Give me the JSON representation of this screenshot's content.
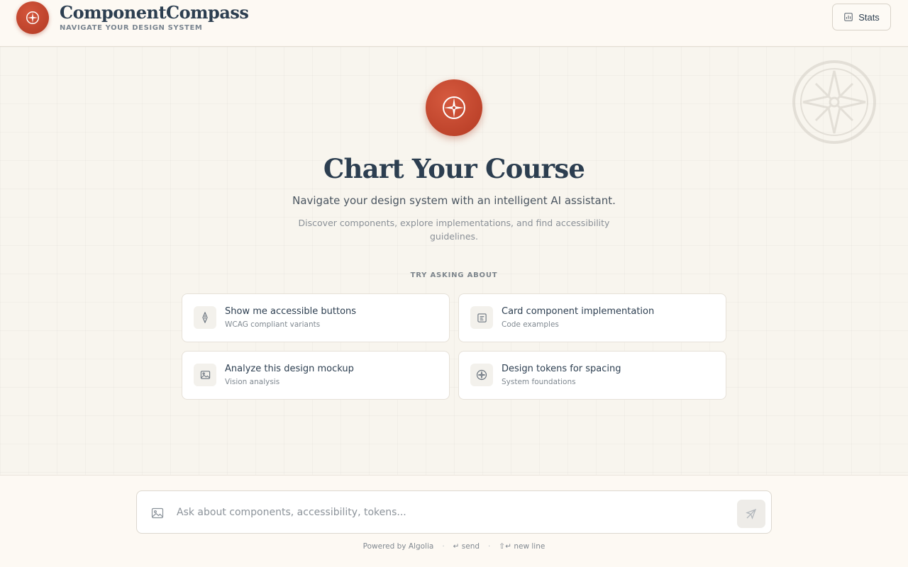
{
  "header": {
    "brand_title": "ComponentCompass",
    "brand_subtitle": "NAVIGATE YOUR DESIGN SYSTEM",
    "stats_label": "Stats"
  },
  "hero": {
    "title": "Chart Your Course",
    "subtitle": "Navigate your design system with an intelligent AI assistant.",
    "description": "Discover components, explore implementations, and find accessibility guidelines."
  },
  "suggestions": {
    "label": "TRY ASKING ABOUT",
    "cards": [
      {
        "title": "Show me accessible buttons",
        "subtitle": "WCAG compliant variants",
        "icon": "pen-nib-icon"
      },
      {
        "title": "Card component implementation",
        "subtitle": "Code examples",
        "icon": "code-file-icon"
      },
      {
        "title": "Analyze this design mockup",
        "subtitle": "Vision analysis",
        "icon": "image-icon"
      },
      {
        "title": "Design tokens for spacing",
        "subtitle": "System foundations",
        "icon": "compass-icon"
      }
    ]
  },
  "composer": {
    "placeholder": "Ask about components, accessibility, tokens...",
    "value": ""
  },
  "footer_hints": {
    "powered_by": "Powered by Algolia",
    "send": "↵ send",
    "new_line": "⇧↵ new line"
  },
  "colors": {
    "accent": "#c0432a",
    "text_primary": "#2c3e50",
    "background": "#f8f5ee"
  }
}
